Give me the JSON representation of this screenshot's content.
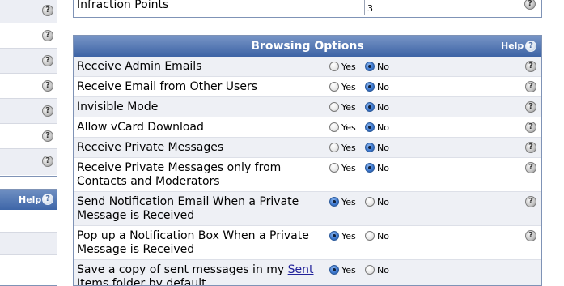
{
  "help_glyph": "?",
  "left_panel": {
    "help_label": "Help"
  },
  "infraction": {
    "label": "Infraction Points",
    "value": "3"
  },
  "browsing": {
    "title": "Browsing Options",
    "help_label": "Help",
    "yes_label": "Yes",
    "no_label": "No",
    "rows": [
      {
        "line1": "Receive Admin Emails",
        "line2": "",
        "selected": "no"
      },
      {
        "line1": "Receive Email from Other Users",
        "line2": "",
        "selected": "no"
      },
      {
        "line1": "Invisible Mode",
        "line2": "",
        "selected": "no"
      },
      {
        "line1": "Allow vCard Download",
        "line2": "",
        "selected": "no"
      },
      {
        "line1": "Receive Private Messages",
        "line2": "",
        "selected": "no"
      },
      {
        "line1": "Receive Private Messages only from",
        "line2": "Contacts and Moderators",
        "selected": "no"
      },
      {
        "line1": "Send Notification Email When a Private",
        "line2": "Message is Received",
        "selected": "yes"
      },
      {
        "line1": "Pop up a Notification Box When a Private",
        "line2": "Message is Received",
        "selected": "yes"
      },
      {
        "line1_prefix": "Save a copy of sent messages in my ",
        "line1_link": "Sent",
        "line2": "Items folder by default",
        "selected": "yes"
      }
    ]
  },
  "colors": {
    "header_top": "#7795c6",
    "header_bottom": "#3d63a5",
    "row_alt": "#eef0f5",
    "border": "#7f93b6"
  }
}
